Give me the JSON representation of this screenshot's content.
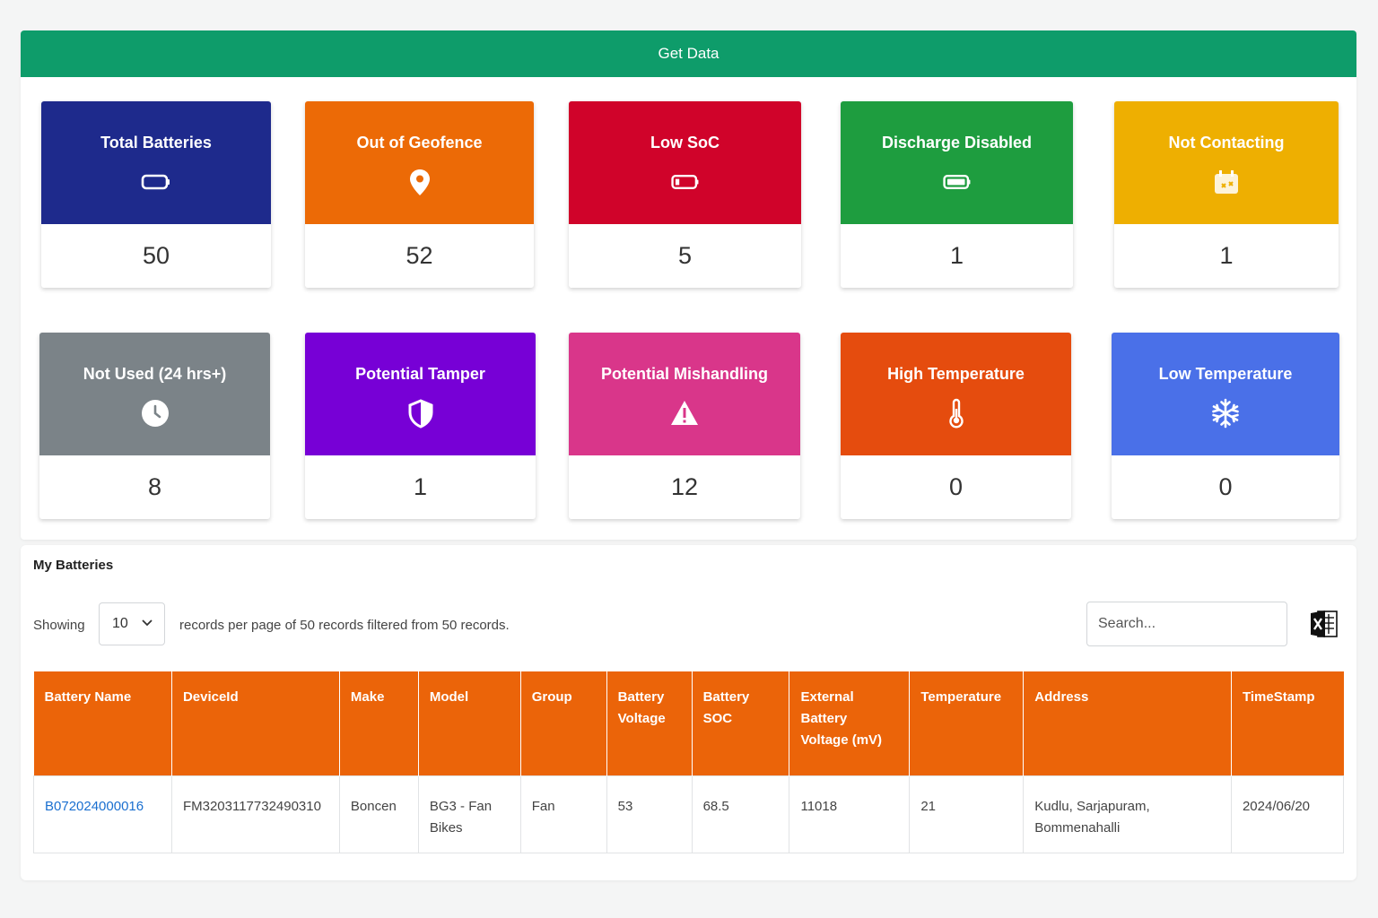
{
  "header": {
    "get_data_label": "Get Data"
  },
  "colors": {
    "get_data_bg": "#0e9c6a",
    "table_header_bg": "#eb6409",
    "link": "#1a6fd0"
  },
  "cards": [
    {
      "title": "Total Batteries",
      "value": "50",
      "color": "#1e2a8c",
      "icon": "battery-icon"
    },
    {
      "title": "Out of Geofence",
      "value": "52",
      "color": "#ec6a06",
      "icon": "location-pin-icon"
    },
    {
      "title": "Low SoC",
      "value": "5",
      "color": "#d0032a",
      "icon": "low-battery-icon"
    },
    {
      "title": "Discharge Disabled",
      "value": "1",
      "color": "#1e9d3f",
      "icon": "battery-full-icon"
    },
    {
      "title": "Not Contacting",
      "value": "1",
      "color": "#eeaf01",
      "icon": "calendar-icon"
    },
    {
      "title": "Not Used (24 hrs+)",
      "value": "8",
      "color": "#7b8388",
      "icon": "clock-icon"
    },
    {
      "title": "Potential Tamper",
      "value": "1",
      "color": "#7700d6",
      "icon": "shield-icon"
    },
    {
      "title": "Potential Mishandling",
      "value": "12",
      "color": "#d9368a",
      "icon": "warning-icon"
    },
    {
      "title": "High Temperature",
      "value": "0",
      "color": "#e54c0e",
      "icon": "thermometer-icon"
    },
    {
      "title": "Low Temperature",
      "value": "0",
      "color": "#4a70e8",
      "icon": "snowflake-icon"
    }
  ],
  "batteries": {
    "title": "My Batteries",
    "showing_label": "Showing",
    "page_size": "10",
    "records_text": "records per page of 50 records filtered from 50 records.",
    "search_placeholder": "Search...",
    "export_icon": "excel-icon",
    "columns": [
      "Battery Name",
      "DeviceId",
      "Make",
      "Model",
      "Group",
      "Battery Voltage",
      "Battery SOC",
      "External Battery Voltage (mV)",
      "Temperature",
      "Address",
      "TimeStamp"
    ],
    "rows": [
      [
        "B072024000016",
        "FM3203117732490310",
        "Boncen",
        "BG3 - Fan Bikes",
        "Fan",
        "53",
        "68.5",
        "11018",
        "21",
        "Kudlu, Sarjapuram, Bommenahalli",
        "2024/06/20"
      ]
    ]
  }
}
